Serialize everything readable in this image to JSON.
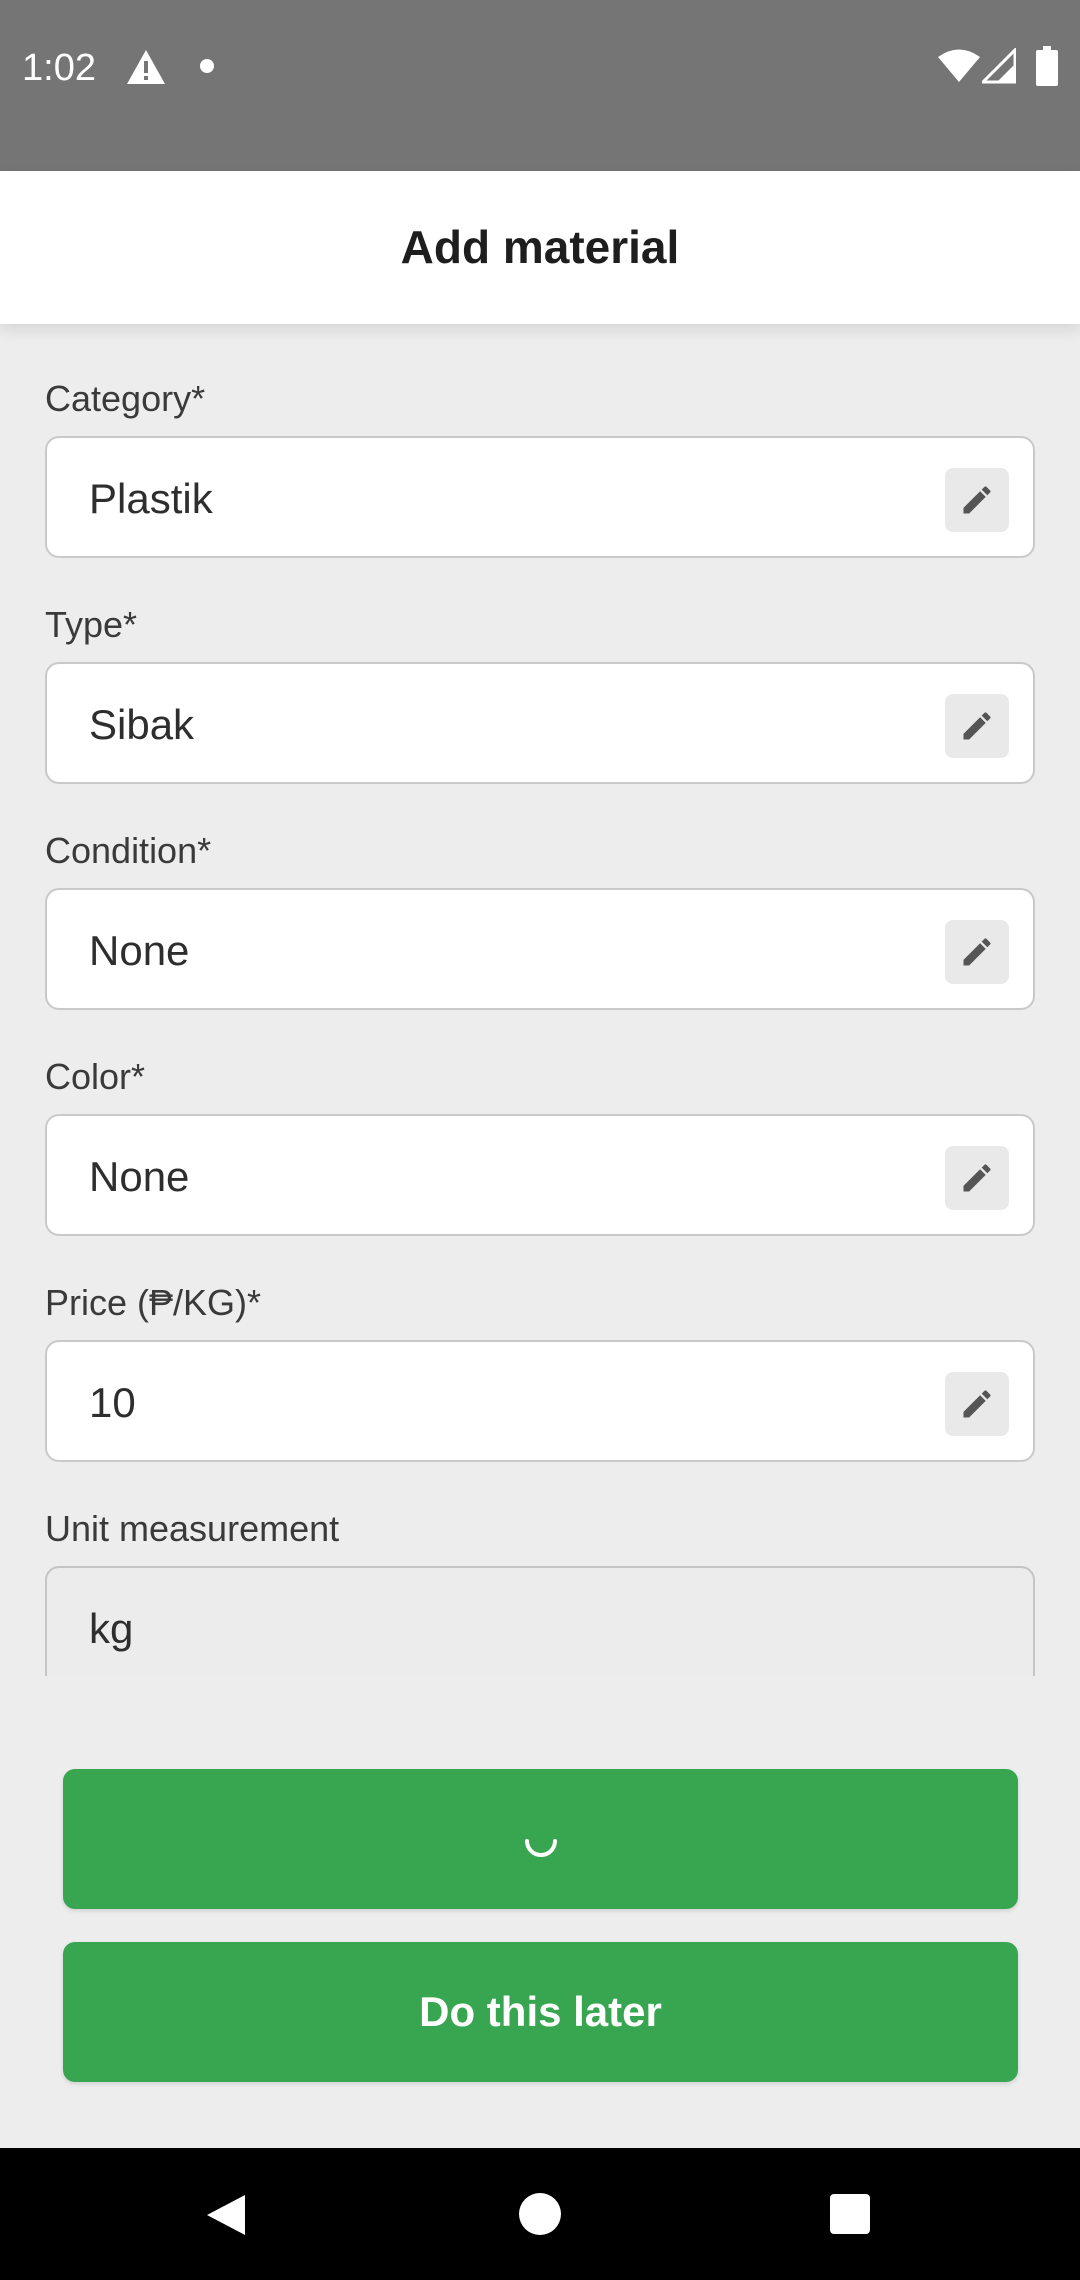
{
  "status_bar": {
    "time": "1:02",
    "icons": [
      "warning-icon",
      "notification-dot-icon",
      "wifi-icon",
      "signal-icon",
      "battery-icon"
    ]
  },
  "app_bar": {
    "title": "Add material"
  },
  "fields": [
    {
      "label": "Category*",
      "value": "Plastik",
      "editable": true,
      "edit_icon": "pencil-icon"
    },
    {
      "label": "Type*",
      "value": "Sibak",
      "editable": true,
      "edit_icon": "pencil-icon"
    },
    {
      "label": "Condition*",
      "value": "None",
      "editable": true,
      "edit_icon": "pencil-icon"
    },
    {
      "label": "Color*",
      "value": "None",
      "editable": true,
      "edit_icon": "pencil-icon"
    },
    {
      "label": "Price (₱/KG)*",
      "value": "10",
      "editable": true,
      "edit_icon": "pencil-icon"
    },
    {
      "label": "Unit measurement",
      "value": "kg",
      "editable": false
    }
  ],
  "buttons": {
    "submit_state": "loading",
    "later_label": "Do this later"
  },
  "colors": {
    "accent_green": "#38a650",
    "status_bar": "#757575",
    "background": "#ededed"
  },
  "nav_bar": {
    "icons": [
      "back-icon",
      "home-icon",
      "recent-apps-icon"
    ]
  }
}
